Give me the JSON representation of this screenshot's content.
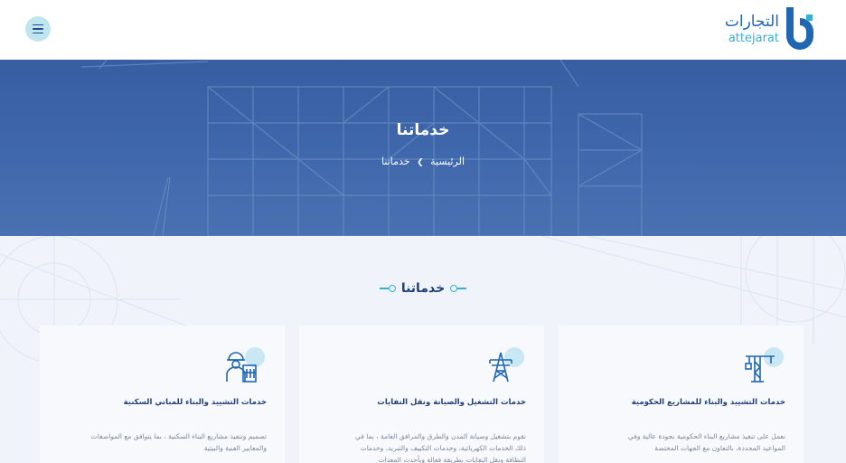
{
  "header": {
    "logo_ar": "التجارات",
    "logo_en": "attejarat",
    "menu_icon": "hamburger-icon"
  },
  "hero": {
    "title": "خدماتنا",
    "breadcrumb": {
      "home": "الرئيسية",
      "separator_icon": "chevron-left-icon",
      "current": "خدماتنا"
    }
  },
  "services": {
    "title": "خدماتنا",
    "cards": [
      {
        "icon": "crane-icon",
        "title": "خدمات التشييد والبناء للمشاريع الحكومية",
        "description": "نعمل على تنفيذ مشاريع البناء الحكومية بجودة عالية وفي المواعيد المحددة، بالتعاون مع الجهات المختصة"
      },
      {
        "icon": "power-tower-icon",
        "title": "خدمات التشغيل والصيانة ونقل النفايات",
        "description": "نقوم بتشغيل وصيانة المدن والطرق والمرافق العامة ، بما في ذلك الخدمات الكهربائية، وخدمات التكييف والتبريد، وخدمات النظافة ونقل النفايات بطريقة فعالة وبأحدث المعدات"
      },
      {
        "icon": "engineer-icon",
        "title": "خدمات التشييد والبناء للمباني السكنية",
        "description": "تصميم وتنفيذ مشاريع البناء السكنية ، بما يتوافق مع المواصفات والمعايير الفنية والبيئية"
      }
    ]
  },
  "colors": {
    "brand_blue": "#1f67b3",
    "accent_cyan": "#35b0d4",
    "heading_navy": "#1f3f7a"
  }
}
